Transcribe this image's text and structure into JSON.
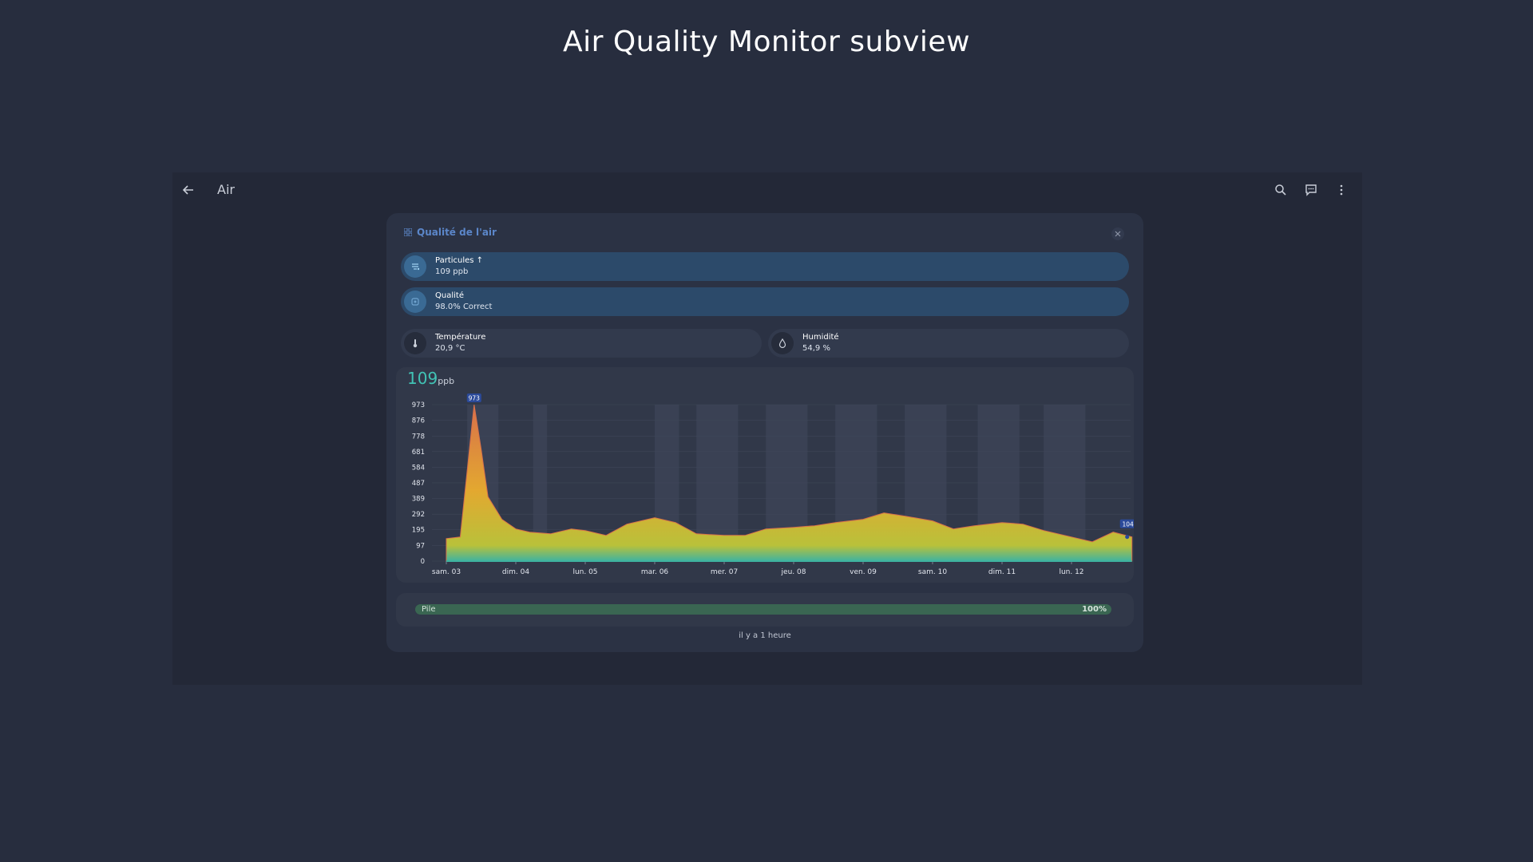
{
  "page": {
    "title": "Air Quality Monitor subview"
  },
  "topbar": {
    "back_icon": "arrow-left-icon",
    "title": "Air",
    "icons": [
      "search-icon",
      "message-icon",
      "more-vertical-icon"
    ]
  },
  "dialog": {
    "title": "Qualité de l'air",
    "title_icon": "grid-icon",
    "close_icon": "close-icon",
    "entities": [
      {
        "name": "Particules ↑",
        "value": "109 ppb",
        "icon": "particles-icon"
      },
      {
        "name": "Qualité",
        "value": "98.0% Correct",
        "icon": "quality-icon"
      }
    ],
    "small_entities": [
      {
        "name": "Température",
        "value": "20,9 °C",
        "icon": "thermometer-icon"
      },
      {
        "name": "Humidité",
        "value": "54,9 %",
        "icon": "water-drop-icon"
      }
    ],
    "battery": {
      "label": "Pile",
      "percent_text": "100%",
      "level": 1.0,
      "color": "#3a6652"
    },
    "last_update": "il y a 1 heure"
  },
  "chart_data": {
    "type": "area",
    "current_value": "109",
    "unit": "ppb",
    "y_ticks": [
      "0",
      "97",
      "195",
      "292",
      "389",
      "487",
      "584",
      "681",
      "778",
      "876",
      "973"
    ],
    "ylim": [
      0,
      973
    ],
    "x_labels": [
      "sam. 03",
      "dim. 04",
      "lun. 05",
      "mar. 06",
      "mer. 07",
      "jeu. 08",
      "ven. 09",
      "sam. 10",
      "dim. 11",
      "lun. 12"
    ],
    "max_label": "973",
    "last_label": "104",
    "colors": {
      "top": "#d8704a",
      "middle": "#e3a830",
      "bottom": "#b9c13a",
      "base": "#3fb3a0",
      "label_bg": "#2b4a9a"
    },
    "series": [
      {
        "x": [
          0,
          0.2,
          0.4,
          0.5,
          0.6,
          0.8,
          1,
          1.2,
          1.5,
          1.8,
          2.0,
          2.3,
          2.6,
          3.0,
          3.3,
          3.6,
          4.0,
          4.3,
          4.6,
          5.0,
          5.3,
          5.6,
          6.0,
          6.3,
          6.6,
          7.0,
          7.3,
          7.6,
          8.0,
          8.3,
          8.6,
          9.0,
          9.3,
          9.6,
          9.87
        ],
        "values": [
          140,
          150,
          973,
          700,
          400,
          260,
          200,
          180,
          170,
          200,
          190,
          160,
          230,
          270,
          240,
          170,
          160,
          160,
          200,
          210,
          220,
          240,
          260,
          300,
          280,
          250,
          200,
          220,
          240,
          230,
          190,
          150,
          120,
          180,
          150
        ]
      }
    ],
    "grid": true
  }
}
